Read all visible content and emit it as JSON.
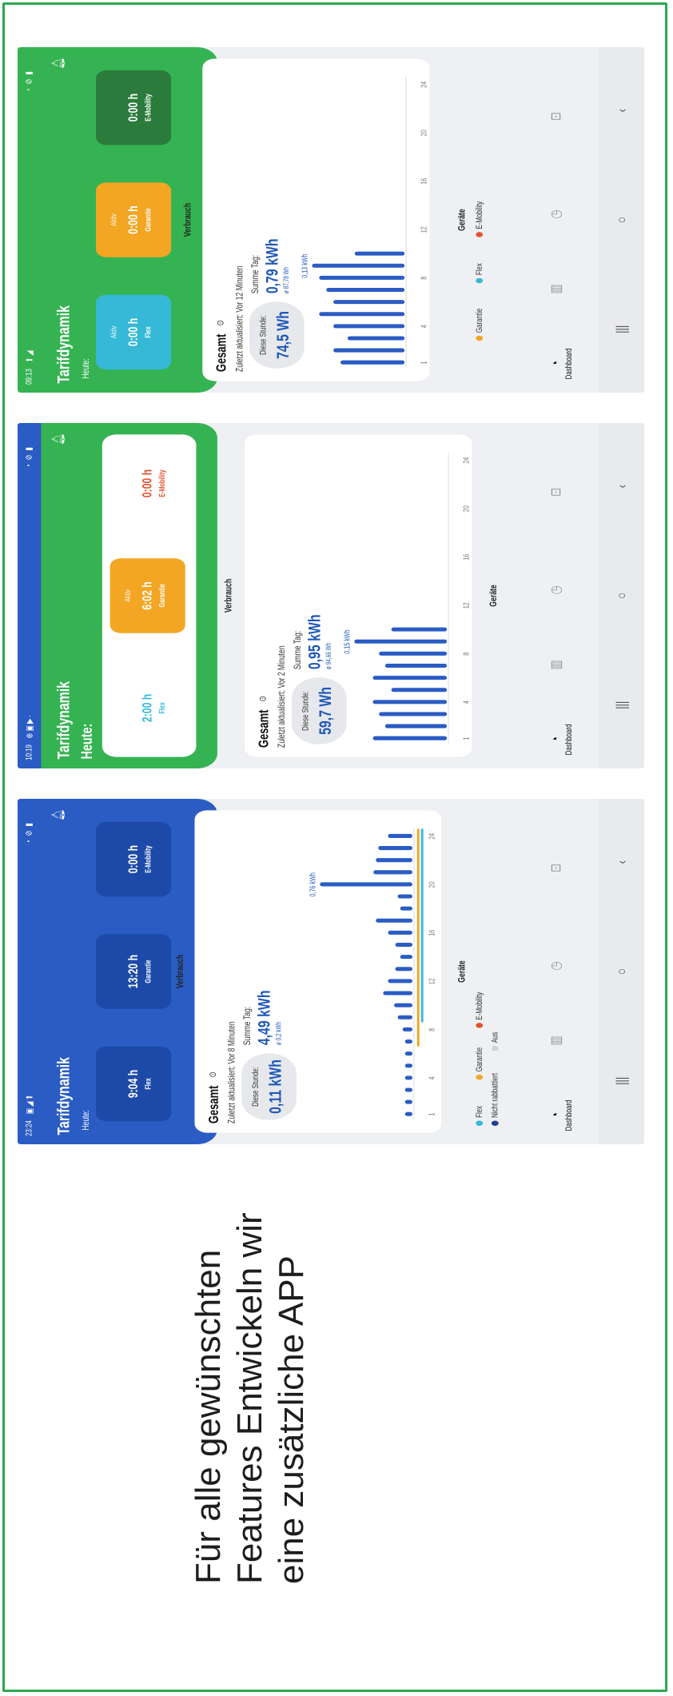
{
  "headline": [
    "Für alle gewünschten",
    "Features Entwickeln wir",
    "eine zusätzliche APP"
  ],
  "colors": {
    "frame": "#2fa84f",
    "blue": "#2a5cc4",
    "green": "#35b352",
    "orange": "#f2a623",
    "red": "#e4522f",
    "cyan": "#35b9d6",
    "navy": "#1f58b8"
  },
  "phones": [
    {
      "status_time": "23:24",
      "status_icons": "▣ ◢ ⬆",
      "status_right": "◔ ⊘ ▮",
      "title": "Tarifdynamik",
      "today": "Heute:",
      "tiles": [
        {
          "sub": "",
          "value": "9:04 h",
          "label": "Flex"
        },
        {
          "sub": "",
          "value": "13:20 h",
          "label": "Garantie"
        },
        {
          "sub": "",
          "value": "0:00 h",
          "label": "E-Mobility"
        }
      ],
      "section": "Verbrauch",
      "gesamt": "Gesamt",
      "updated": "Zuletzt aktualisiert: Vor 8 Minuten",
      "hour_label": "Diese Stunde:",
      "hour_value": "0,11 kWh",
      "day_label": "Summe Tag:",
      "day_value": "4,49 kWh",
      "day_avg": "ø 0,2 kWh",
      "legend_title": "Geräte",
      "legend": [
        "Flex",
        "Garantie",
        "E-Mobility",
        "Nicht rabbattiert",
        "Aus"
      ],
      "tab_label": "Dashboard"
    },
    {
      "status_time": "10:19",
      "status_icons": "⊛ ▣ ▶ ·",
      "status_right": "◔ ⊘ ▮",
      "title": "Tarifdynamik",
      "today": "Heute:",
      "tiles": [
        {
          "sub": "",
          "value": "2:00 h",
          "label": "Flex"
        },
        {
          "sub": "Aktiv",
          "value": "6:02 h",
          "label": "Garantie"
        },
        {
          "sub": "",
          "value": "0:00 h",
          "label": "E-Mobility"
        }
      ],
      "section": "Verbrauch",
      "gesamt": "Gesamt",
      "updated": "Zuletzt aktualisiert: Vor 2 Minuten",
      "hour_label": "Diese Stunde:",
      "hour_value": "59,7 Wh",
      "day_label": "Summe Tag:",
      "day_value": "0,95 kWh",
      "day_avg": "ø 94,66 Wh",
      "legend_title": "Geräte",
      "legend": [],
      "tab_label": "Dashboard"
    },
    {
      "status_time": "09:13",
      "status_icons": "⬆ ◢",
      "status_right": "◔ ⊘ ▮",
      "title": "Tarifdynamik",
      "today": "Heute:",
      "tiles": [
        {
          "sub": "Aktiv",
          "value": "0:00 h",
          "label": "Flex"
        },
        {
          "sub": "Aktiv",
          "value": "0:00 h",
          "label": "Garantie"
        },
        {
          "sub": "",
          "value": "0:00 h",
          "label": "E-Mobility"
        }
      ],
      "section": "Verbrauch",
      "gesamt": "Gesamt",
      "updated": "Zuletzt aktualisiert: Vor 12 Minuten",
      "hour_label": "Diese Stunde:",
      "hour_value": "74,5 Wh",
      "day_label": "Summe Tag:",
      "day_value": "0,79 kWh",
      "day_avg": "ø 87,78 Wh",
      "legend_title": "Geräte",
      "legend": [
        "Garantie",
        "Flex",
        "E-Mobility"
      ],
      "tab_label": "Dashboard"
    }
  ],
  "chart_data": [
    {
      "type": "bar",
      "x_ticks": [
        "1",
        "4",
        "8",
        "12",
        "16",
        "20",
        "24"
      ],
      "peak_label": "0,76 kWh",
      "values": [
        0.06,
        0.06,
        0.06,
        0.06,
        0.06,
        0.06,
        0.06,
        0.08,
        0.12,
        0.15,
        0.24,
        0.2,
        0.14,
        0.1,
        0.14,
        0.2,
        0.3,
        0.1,
        0.12,
        0.76,
        0.32,
        0.3,
        0.28,
        0.2
      ]
    },
    {
      "type": "bar",
      "x_ticks": [
        "1",
        "4",
        "8",
        "12",
        "16",
        "20",
        "24"
      ],
      "peak_label": "0,15 kWh",
      "values": [
        0.12,
        0.1,
        0.11,
        0.12,
        0.09,
        0.12,
        0.1,
        0.11,
        0.15,
        0.09
      ]
    },
    {
      "type": "bar",
      "x_ticks": [
        "1",
        "4",
        "8",
        "12",
        "16",
        "20",
        "24"
      ],
      "peak_label": "0,13 kWh",
      "values": [
        0.09,
        0.1,
        0.08,
        0.1,
        0.12,
        0.1,
        0.11,
        0.12,
        0.13,
        0.07
      ]
    }
  ],
  "nav": {
    "menu": "|||",
    "home": "○",
    "back": "‹"
  }
}
